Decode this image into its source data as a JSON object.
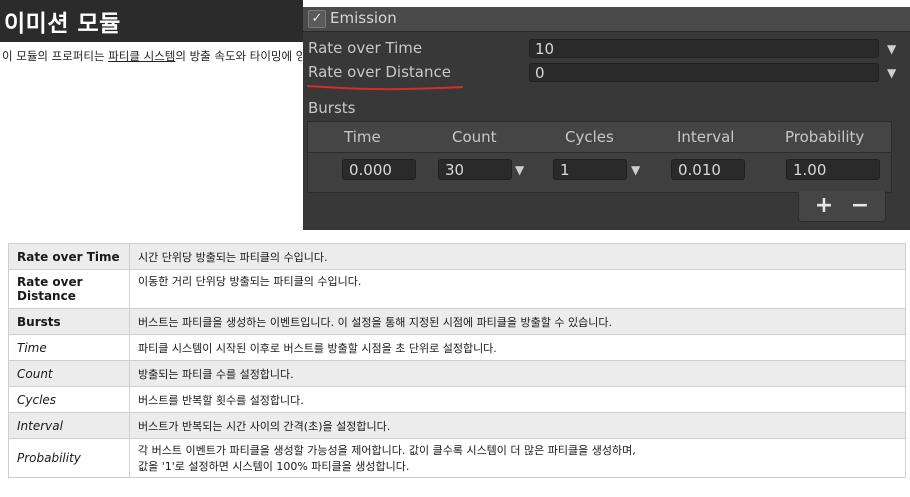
{
  "header": {
    "title": "이미션 모듈",
    "intro_before": "이 모듈의 프로퍼티는 ",
    "intro_link": "파티클 시스템",
    "intro_after": "의 방출 속도와 타이밍에 영향"
  },
  "inspector": {
    "module": {
      "checked": true,
      "check_glyph": "✓",
      "title": "Emission"
    },
    "properties": [
      {
        "label": "Rate over Time",
        "value": "10"
      },
      {
        "label": "Rate over Distance",
        "value": "0"
      }
    ],
    "annotation_color": "#d62b2b",
    "bursts": {
      "label": "Bursts",
      "columns": [
        "Time",
        "Count",
        "Cycles",
        "Interval",
        "Probability"
      ],
      "row": {
        "time": "0.000",
        "count": "30",
        "cycles": "1",
        "interval": "0.010",
        "probability": "1.00"
      },
      "dropdown_glyph": "▼",
      "add_label": "+",
      "remove_label": "−"
    }
  },
  "table": {
    "rows": [
      {
        "name": "Rate over Time",
        "desc": "시간 단위당 방출되는 파티클의 수입니다.",
        "style": "bold",
        "shaded": true
      },
      {
        "name": "Rate over Distance",
        "desc": "이동한 거리 단위당 방출되는 파티클의 수입니다.",
        "style": "bold",
        "shaded": false
      },
      {
        "name": "Bursts",
        "desc": "버스트는 파티클을 생성하는 이벤트입니다. 이 설정을 통해 지정된 시점에 파티클을 방출할 수 있습니다.",
        "style": "bold",
        "shaded": true
      },
      {
        "name": "Time",
        "desc": "파티클 시스템이 시작된 이후로 버스트를 방출할 시점을 초 단위로 설정합니다.",
        "style": "ital",
        "shaded": false
      },
      {
        "name": "Count",
        "desc": "방출되는 파티클 수를 설정합니다.",
        "style": "ital",
        "shaded": true
      },
      {
        "name": "Cycles",
        "desc": "버스트를 반복할 횟수를 설정합니다.",
        "style": "ital",
        "shaded": false
      },
      {
        "name": "Interval",
        "desc": "버스트가 반복되는 시간 사이의 간격(초)을 설정합니다.",
        "style": "ital",
        "shaded": true
      },
      {
        "name": "Probability",
        "desc": "각 버스트 이벤트가 파티클을 생성할 가능성을 제어합니다. 값이 클수록 시스템이 더 많은 파티클을 생성하며,",
        "desc2": "값을 '1'로 설정하면 시스템이 100% 파티클을 생성합니다.",
        "style": "ital",
        "shaded": false
      }
    ]
  }
}
